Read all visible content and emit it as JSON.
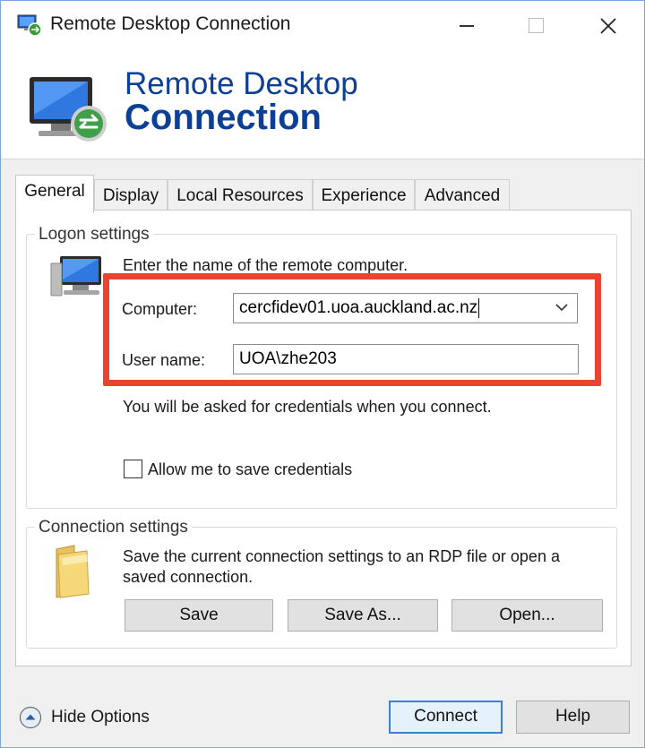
{
  "window": {
    "title": "Remote Desktop Connection",
    "controls": {
      "minimize": "minimize",
      "maximize": "maximize",
      "close": "close"
    }
  },
  "banner": {
    "line1": "Remote Desktop",
    "line2": "Connection"
  },
  "tabs": [
    {
      "label": "General",
      "active": true
    },
    {
      "label": "Display",
      "active": false
    },
    {
      "label": "Local Resources",
      "active": false
    },
    {
      "label": "Experience",
      "active": false
    },
    {
      "label": "Advanced",
      "active": false
    }
  ],
  "logon": {
    "group_label": "Logon settings",
    "instruction": "Enter the name of the remote computer.",
    "computer_label": "Computer:",
    "computer_value": "cercfidev01.uoa.auckland.ac.nz",
    "username_label": "User name:",
    "username_value": "UOA\\zhe203",
    "credentials_note": "You will be asked for credentials when you connect.",
    "save_credentials_label": "Allow me to save credentials",
    "save_credentials_checked": false
  },
  "connection": {
    "group_label": "Connection settings",
    "description_line1": "Save the current connection settings to an RDP file or open a",
    "description_line2": "saved connection.",
    "save_label": "Save",
    "save_as_label": "Save As...",
    "open_label": "Open..."
  },
  "footer": {
    "hide_options_label": "Hide Options",
    "connect_label": "Connect",
    "help_label": "Help"
  },
  "colors": {
    "accent_blue": "#0c3f96",
    "highlight_red": "#e94332",
    "default_button_border": "#3c7fd0"
  }
}
